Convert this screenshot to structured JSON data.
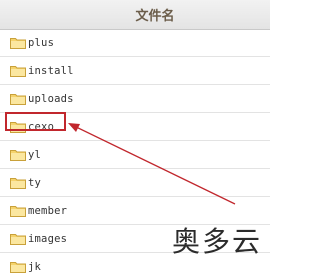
{
  "header": {
    "title": "文件名"
  },
  "files": [
    {
      "name": "plus"
    },
    {
      "name": "install"
    },
    {
      "name": "uploads"
    },
    {
      "name": "cexo"
    },
    {
      "name": "yl"
    },
    {
      "name": "ty"
    },
    {
      "name": "member"
    },
    {
      "name": "images"
    },
    {
      "name": "jk"
    }
  ],
  "watermark": {
    "text": "奥多云"
  },
  "colors": {
    "annotation": "#c1272d",
    "folder": "#f5d36c"
  }
}
